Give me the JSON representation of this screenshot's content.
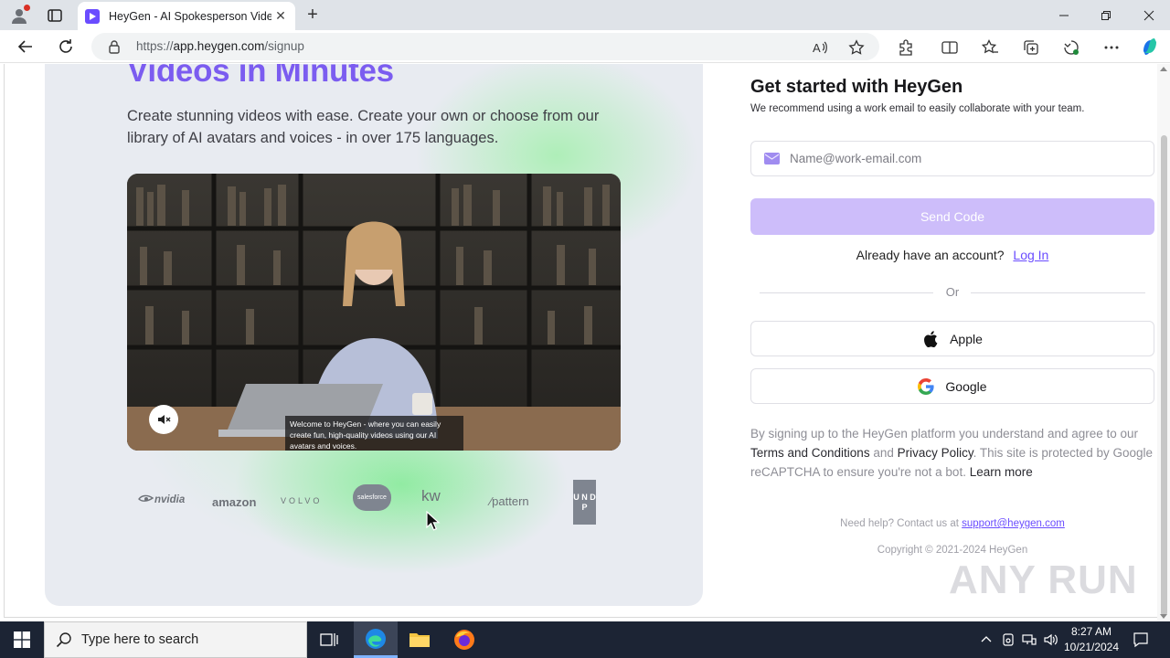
{
  "browser": {
    "tab_title": "HeyGen - AI Spokesperson Video",
    "url_proto": "https://",
    "url_host": "app.heygen.com",
    "url_path": "/signup"
  },
  "hero": {
    "title": "Videos in Minutes",
    "subtitle": "Create stunning videos with ease. Create your own or choose from our library of AI avatars and voices - in over 175 languages.",
    "caption": "Welcome to HeyGen - where you can easily create fun, high-quality videos using our AI avatars and voices.",
    "logos": [
      "nvidia",
      "amazon",
      "VOLVO",
      "salesforce",
      "kw",
      "pattern",
      "U N D P"
    ]
  },
  "signup": {
    "title": "Get started with HeyGen",
    "subtitle": "We recommend using a work email to easily collaborate with your team.",
    "email_placeholder": "Name@work-email.com",
    "send_code": "Send Code",
    "already_text": "Already have an account?",
    "login_link": "Log In",
    "or_text": "Or",
    "apple_label": "Apple",
    "google_label": "Google",
    "legal_1": "By signing up to the HeyGen platform you understand and agree to our ",
    "terms_link": "Terms and Conditions",
    "legal_and": " and ",
    "privacy_link": "Privacy Policy",
    "legal_2": ". This site is protected by Google reCAPTCHA to ensure you're not a bot. ",
    "learn_more": "Learn more",
    "help_text": "Need help? Contact us at ",
    "support_email": "support@heygen.com",
    "copyright": "Copyright © 2021-2024 HeyGen"
  },
  "watermark": "ANY RUN",
  "taskbar": {
    "search_placeholder": "Type here to search",
    "time": "8:27 AM",
    "date": "10/21/2024"
  },
  "colors": {
    "brand": "#7b5cf0",
    "send_disabled": "#cdbdfa",
    "link": "#6a4cff",
    "taskbar": "#1c2434"
  }
}
